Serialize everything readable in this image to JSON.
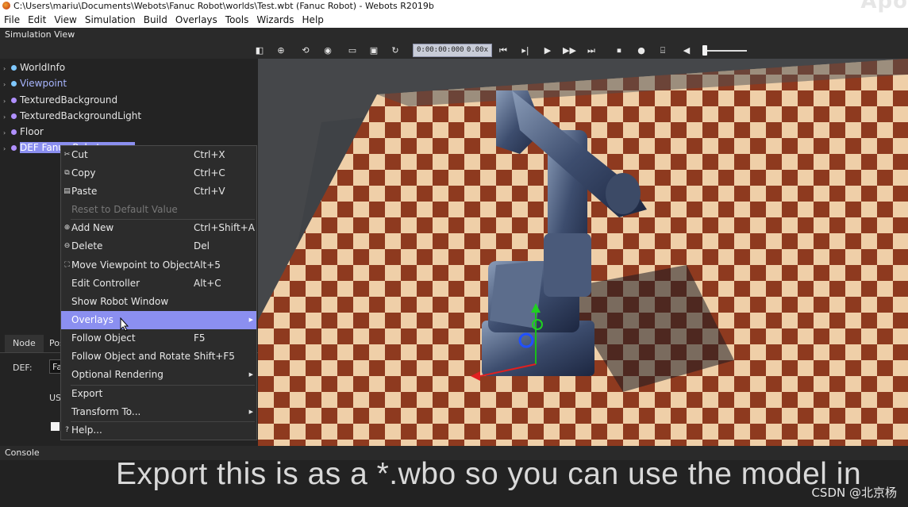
{
  "window": {
    "title": "C:\\Users\\mariu\\Documents\\Webots\\Fanuc Robot\\worlds\\Test.wbt (Fanuc Robot) - Webots R2019b",
    "watermark": "Apo"
  },
  "menubar": [
    "File",
    "Edit",
    "View",
    "Simulation",
    "Build",
    "Overlays",
    "Tools",
    "Wizards",
    "Help"
  ],
  "panel_title": "Simulation View",
  "toolbar": {
    "time": "0:00:00:000",
    "speed": "0.00x"
  },
  "scene_tree": [
    {
      "label": "WorldInfo",
      "dot": "#7fc8ff"
    },
    {
      "label": "Viewpoint",
      "dot": "#7fc8ff"
    },
    {
      "label": "TexturedBackground",
      "dot": "#b090ff"
    },
    {
      "label": "TexturedBackgroundLight",
      "dot": "#b090ff"
    },
    {
      "label": "Floor",
      "dot": "#b090ff"
    },
    {
      "label": "DEF Fanuc Robot",
      "dot": "#b090ff"
    }
  ],
  "context_menu": [
    {
      "label": "Cut",
      "shortcut": "Ctrl+X",
      "icon": "scissors-icon"
    },
    {
      "label": "Copy",
      "shortcut": "Ctrl+C",
      "icon": "copy-icon"
    },
    {
      "label": "Paste",
      "shortcut": "Ctrl+V",
      "icon": "paste-icon"
    },
    {
      "label": "Reset to Default Value",
      "shortcut": ""
    },
    {
      "label": "Add New",
      "shortcut": "Ctrl+Shift+A",
      "icon": "add-icon"
    },
    {
      "label": "Delete",
      "shortcut": "Del",
      "icon": "minus-icon"
    },
    {
      "label": "Move Viewpoint to Object",
      "shortcut": "Alt+5",
      "icon": "move-viewpoint-icon"
    },
    {
      "label": "Edit Controller",
      "shortcut": "Alt+C"
    },
    {
      "label": "Show Robot Window",
      "shortcut": ""
    },
    {
      "label": "Overlays",
      "shortcut": ""
    },
    {
      "label": "Follow Object",
      "shortcut": "F5"
    },
    {
      "label": "Follow Object and Rotate",
      "shortcut": "Shift+F5"
    },
    {
      "label": "Optional Rendering",
      "shortcut": ""
    },
    {
      "label": "Export",
      "shortcut": ""
    },
    {
      "label": "Transform To...",
      "shortcut": ""
    },
    {
      "label": "Help...",
      "shortcut": "",
      "icon": "help-icon"
    }
  ],
  "properties": {
    "tabs": [
      "Node",
      "Pos"
    ],
    "def_label": "DEF:",
    "def_value": "Fa",
    "use_label": "US"
  },
  "console_label": "Console",
  "subtitle": "Export this is as a *.wbo so you can use the model in",
  "watermark_bottom": "CSDN @北京杨"
}
